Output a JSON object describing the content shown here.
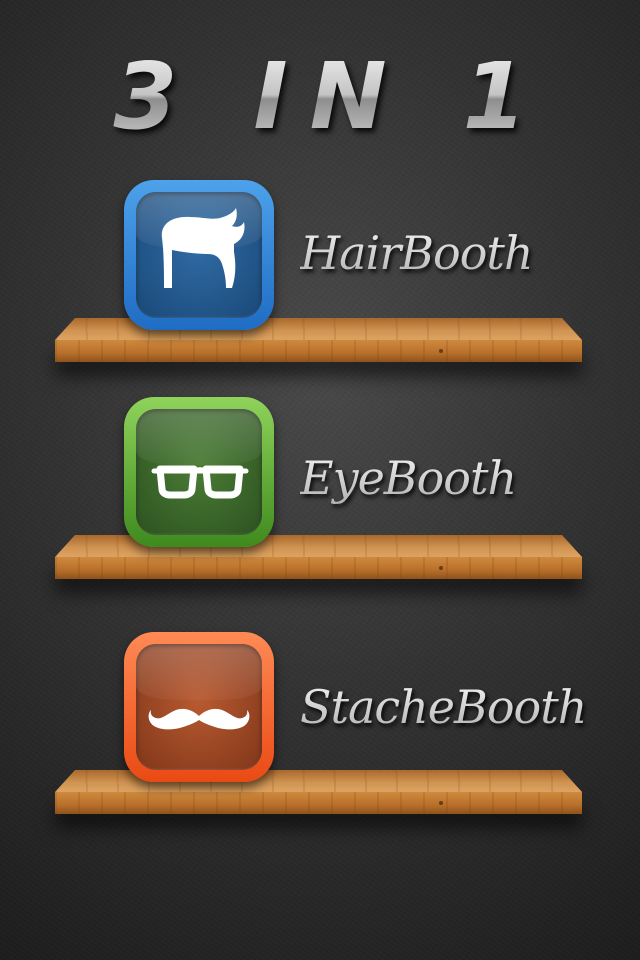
{
  "header": {
    "title": "3 IN 1"
  },
  "apps": [
    {
      "label": "HairBooth",
      "icon": "hair-icon",
      "color": "#2f6ba4",
      "border_color": "#3b8bdc"
    },
    {
      "label": "EyeBooth",
      "icon": "glasses-icon",
      "color": "#3f6a2c",
      "border_color": "#5fb034"
    },
    {
      "label": "StacheBooth",
      "icon": "mustache-icon",
      "color": "#9a4424",
      "border_color": "#f5612a"
    }
  ],
  "colors": {
    "background": "#333333",
    "shelf_wood": "#c98a45",
    "label_silver": "#d9d9d9"
  }
}
